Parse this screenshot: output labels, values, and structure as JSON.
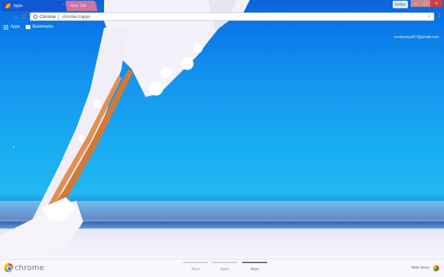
{
  "tabs": [
    {
      "title": "Apps",
      "close": "×"
    },
    {
      "title": "New Tab"
    }
  ],
  "window": {
    "profile_chip": "Evelyn",
    "minimize": "–",
    "maximize": "□",
    "close": "×"
  },
  "nav": {
    "back": "←",
    "forward": "→",
    "reload": "C"
  },
  "omnibox": {
    "site_label": "Chrome",
    "url": "chrome://apps",
    "star": "☆"
  },
  "menu_icon": "⋮",
  "bookmarks": {
    "apps_label": "Apps",
    "bookmarks_label": "Bookmarks"
  },
  "account_email": "evelynsnyd07@gmail.com",
  "page_prev": "‹",
  "bottom": {
    "brand": "chrome",
    "page_tabs": [
      "Apps",
      "Apps",
      "Apps"
    ],
    "active_page_index": 2,
    "webstore_label": "Web Store"
  },
  "colors": {
    "close_button": "#c8423f",
    "sky": "#18aef2",
    "accent_red": "#ff5a5a"
  },
  "icons": {
    "back": "arrow-left-icon",
    "forward": "arrow-right-icon",
    "reload": "reload-icon",
    "star": "star-icon",
    "menu": "kebab-menu-icon",
    "apps": "grid-icon",
    "bookmarks": "folder-icon",
    "brand": "chrome-logo-icon",
    "webstore": "webstore-icon"
  }
}
